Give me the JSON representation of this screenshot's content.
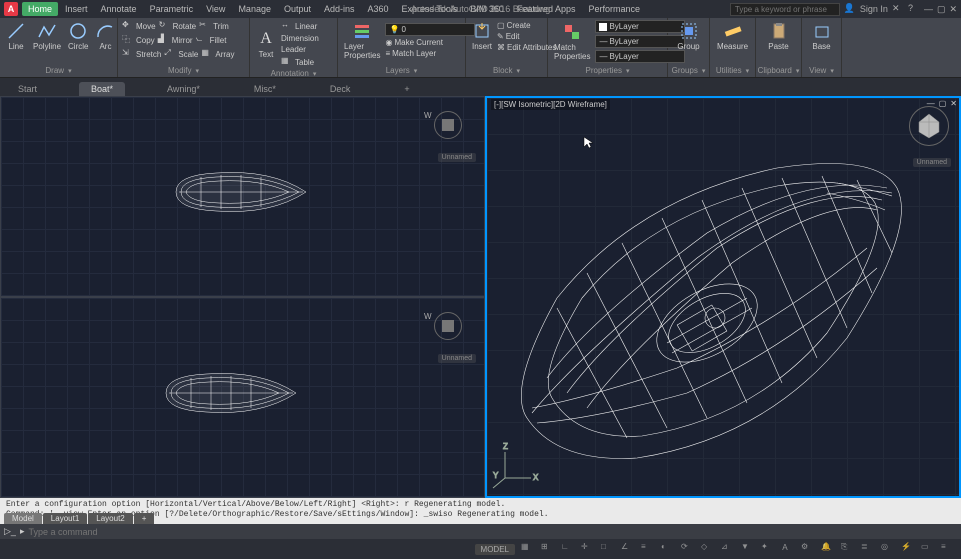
{
  "title": "Autodesk AutoCAD 2016    Boat.dwg",
  "menus": [
    "Home",
    "Insert",
    "Annotate",
    "Parametric",
    "View",
    "Manage",
    "Output",
    "Add-ins",
    "A360",
    "Express Tools",
    "BIM 360",
    "Featured Apps",
    "Performance"
  ],
  "search": {
    "placeholder": "Type a keyword or phrase"
  },
  "user": {
    "label": "Sign In"
  },
  "ribbon": {
    "draw": {
      "label": "Draw",
      "tools": [
        "Line",
        "Polyline",
        "Circle",
        "Arc"
      ]
    },
    "modify": {
      "label": "Modify",
      "items": [
        "Move",
        "Rotate",
        "Trim",
        "Copy",
        "Mirror",
        "Fillet",
        "Stretch",
        "Scale",
        "Array"
      ]
    },
    "annotation": {
      "label": "Annotation",
      "text": "Text",
      "items": [
        "Linear",
        "Dimension",
        "Leader",
        "Table"
      ]
    },
    "layers": {
      "label": "Layers",
      "btn": "Layer Properties",
      "items": [
        "Make Current",
        "Match Layer"
      ],
      "sel": "0"
    },
    "block": {
      "label": "Block",
      "btn": "Insert",
      "items": [
        "Create",
        "Edit",
        "Edit Attributes"
      ]
    },
    "properties": {
      "label": "Properties",
      "btn": "Match Properties",
      "sel1": "ByLayer",
      "sel2": "ByLayer",
      "sel3": "ByLayer"
    },
    "groups": {
      "label": "Groups",
      "btn": "Group"
    },
    "utilities": {
      "label": "Utilities",
      "btn": "Measure"
    },
    "clipboard": {
      "label": "Clipboard",
      "btn": "Paste"
    },
    "view": {
      "label": "View",
      "btn": "Base"
    }
  },
  "docTabs": [
    "Start",
    "Boat*",
    "Awning*",
    "Misc*",
    "Deck"
  ],
  "viewport": {
    "rightTitle": "[-][SW Isometric][2D Wireframe]",
    "nav": "Unnamed",
    "compass": "W"
  },
  "command": {
    "history": "Enter a configuration option [Horizontal/Vertical/Above/Below/Left/Right] <Right>: r Regenerating model.\nCommand: '_-view Enter an option [?/Delete/Orthographic/Restore/Save/sEttings/Window]: _swiso Regenerating model.",
    "prompt": "Type a command"
  },
  "bottomTabs": [
    "Model",
    "Layout1",
    "Layout2"
  ],
  "status": {
    "mode": "MODEL"
  }
}
